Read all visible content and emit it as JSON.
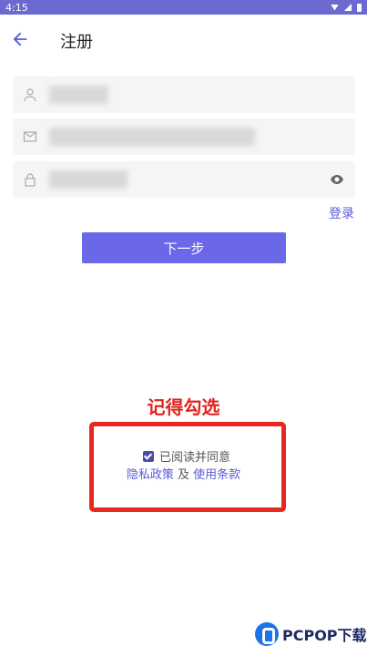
{
  "status_bar": {
    "time": "4:15"
  },
  "header": {
    "title": "注册"
  },
  "form": {
    "username": {
      "value": "██████"
    },
    "email": {
      "value": "█████████████████████"
    },
    "password": {
      "value": "████████"
    }
  },
  "login_link": "登录",
  "next_button": "下一步",
  "reminder": "记得勾选",
  "agreement": {
    "checked": true,
    "text": "已阅读并同意",
    "privacy_link": "隐私政策",
    "and": " 及 ",
    "terms_link": "使用条款"
  },
  "watermark": {
    "text": "PCPOP下载"
  },
  "colors": {
    "accent": "#6a67e8",
    "link": "#5a5ad8",
    "highlight": "#e8271f"
  }
}
